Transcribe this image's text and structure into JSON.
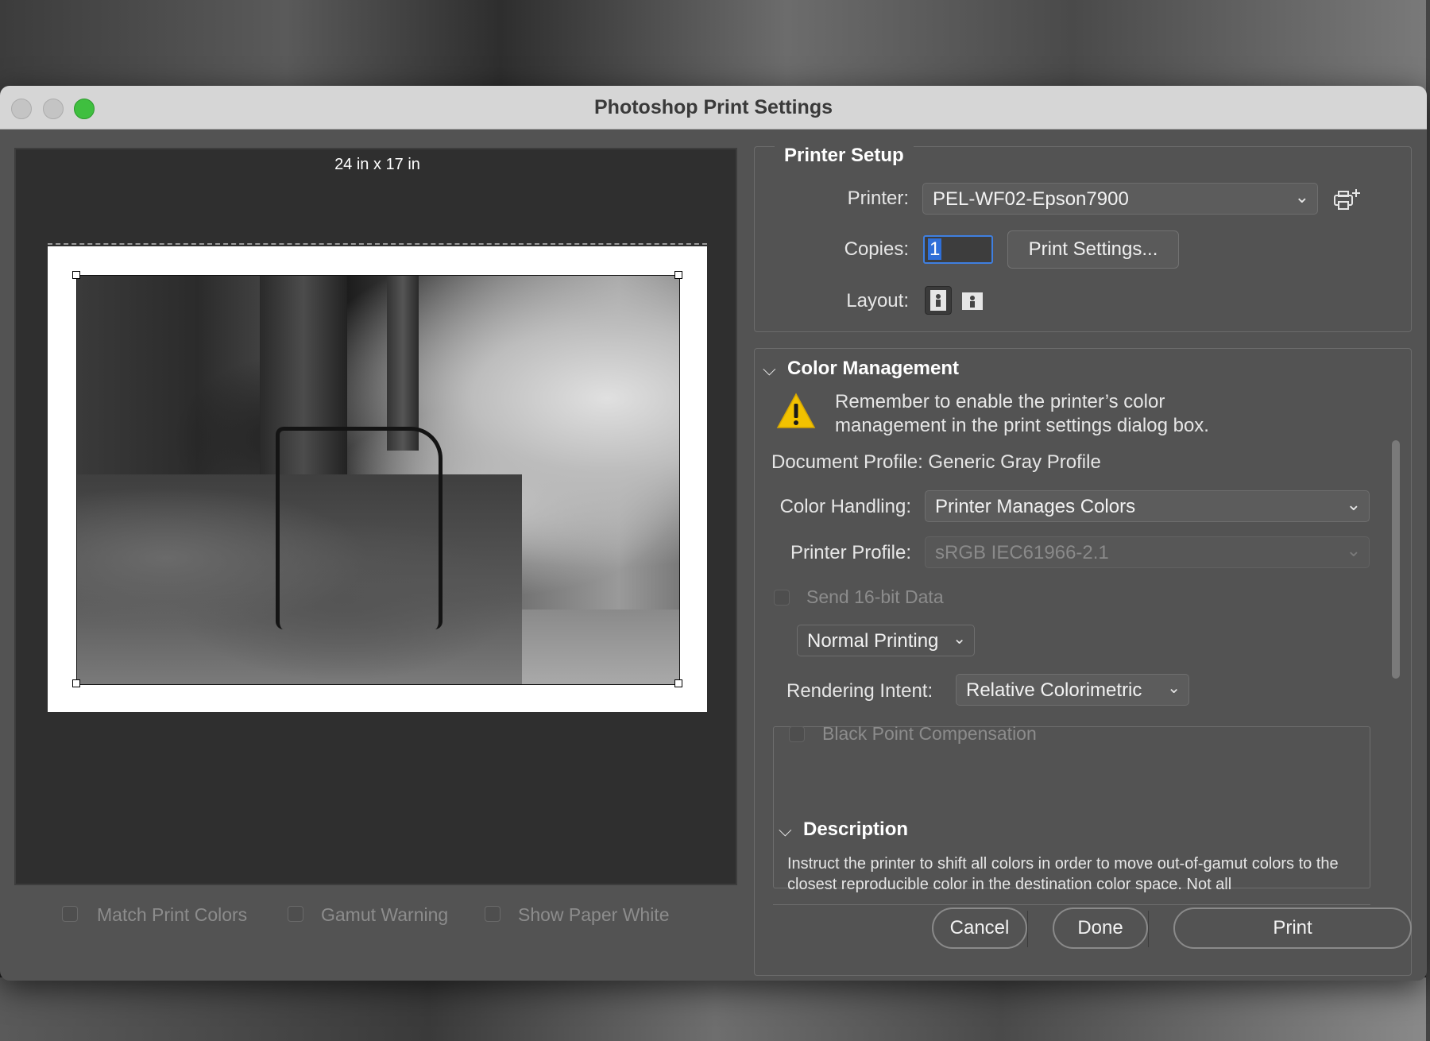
{
  "window": {
    "title": "Photoshop Print Settings"
  },
  "preview": {
    "paper_size": "24 in x 17 in",
    "options": [
      {
        "label": "Match Print Colors",
        "checked": false
      },
      {
        "label": "Gamut Warning",
        "checked": false
      },
      {
        "label": "Show Paper White",
        "checked": false
      }
    ]
  },
  "printer_setup": {
    "title": "Printer Setup",
    "printer_label": "Printer:",
    "printer_value": "PEL-WF02-Epson7900",
    "copies_label": "Copies:",
    "copies_value": "1",
    "print_settings_button": "Print Settings...",
    "layout_label": "Layout:"
  },
  "color_management": {
    "title": "Color Management",
    "warning": "Remember to enable the printer’s color management in the print settings dialog box.",
    "document_profile": "Document Profile: Generic Gray Profile",
    "color_handling_label": "Color Handling:",
    "color_handling_value": "Printer Manages Colors",
    "printer_profile_label": "Printer Profile:",
    "printer_profile_value": "sRGB IEC61966-2.1",
    "send_16bit_label": "Send 16-bit Data",
    "normal_printing_value": "Normal Printing",
    "rendering_intent_label": "Rendering Intent:",
    "rendering_intent_value": "Relative Colorimetric",
    "black_point_label": "Black Point Compensation"
  },
  "description": {
    "title": "Description",
    "text": "Instruct the printer to shift all colors in order to move out-of-gamut colors to the closest reproducible color in the destination color space. Not all"
  },
  "footer": {
    "cancel": "Cancel",
    "done": "Done",
    "print": "Print"
  },
  "colors": {
    "dialog_bg": "#535353",
    "titlebar_bg": "#d6d6d6",
    "accent_focus": "#3f7fe0",
    "maximize_green": "#3fbf3f",
    "warning_yellow": "#f2c200"
  }
}
